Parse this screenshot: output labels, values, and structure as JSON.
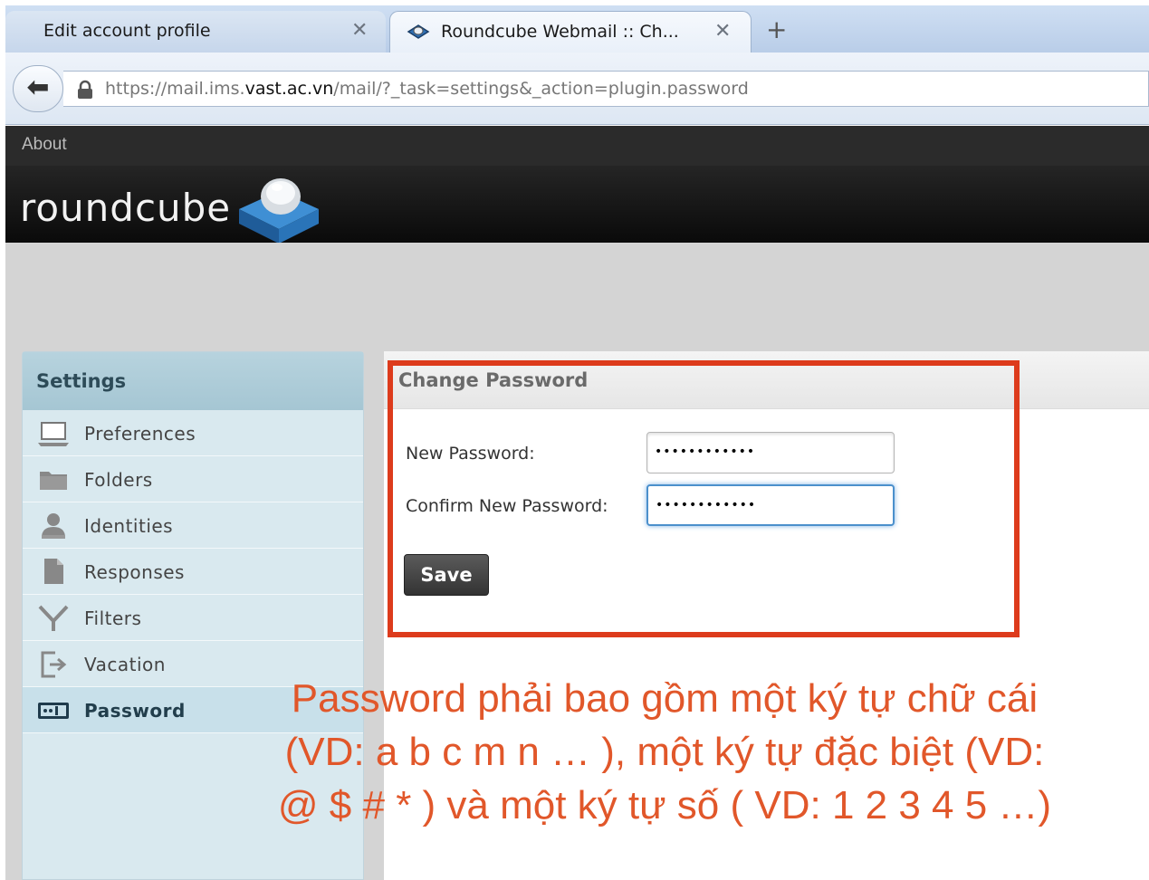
{
  "browser": {
    "tabs": [
      {
        "title": "Edit account profile",
        "close": "✕"
      },
      {
        "title": "Roundcube Webmail :: Ch...",
        "close": "✕"
      }
    ],
    "new_tab": "+",
    "url_prefix": "https://mail.ims.",
    "url_host": "vast.ac.vn",
    "url_path": "/mail/?_task=settings&_action=plugin.password"
  },
  "header": {
    "about": "About",
    "logo": "roundcube"
  },
  "settings": {
    "title": "Settings",
    "items": [
      {
        "label": "Preferences",
        "icon": "laptop-icon"
      },
      {
        "label": "Folders",
        "icon": "folder-icon"
      },
      {
        "label": "Identities",
        "icon": "person-icon"
      },
      {
        "label": "Responses",
        "icon": "document-icon"
      },
      {
        "label": "Filters",
        "icon": "filter-icon"
      },
      {
        "label": "Vacation",
        "icon": "exit-icon"
      },
      {
        "label": "Password",
        "icon": "password-icon",
        "selected": true
      }
    ]
  },
  "form": {
    "title": "Change Password",
    "new_password_label": "New Password:",
    "new_password_value": "••••••••••••",
    "confirm_password_label": "Confirm New Password:",
    "confirm_password_value": "••••••••••••",
    "save": "Save"
  },
  "annotation": {
    "line1": "Password phải bao gồm một ký tự chữ cái",
    "line2": "(VD: a b c m n … ), một ký tự đặc biệt (VD:",
    "line3": "@ $ # * )  và một ký tự số ( VD: 1 2 3 4 5 …)"
  },
  "colors": {
    "annotation": "#e1572a",
    "highlight_border": "#dd3b1c",
    "sidebar": "#d9e9ef",
    "header": "#111111"
  }
}
